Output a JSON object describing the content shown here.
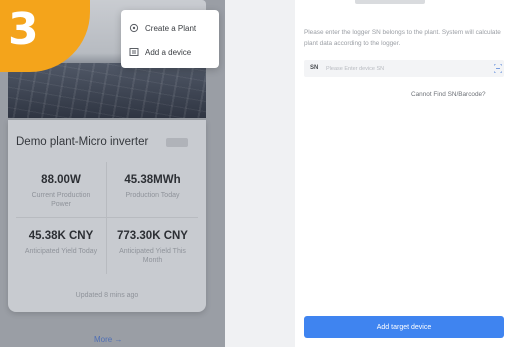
{
  "step": {
    "number": "3"
  },
  "dropdown": {
    "items": [
      {
        "label": "Create a Plant",
        "icon": "plant-icon"
      },
      {
        "label": "Add a device",
        "icon": "device-icon"
      }
    ]
  },
  "plant": {
    "title": "Demo plant-Micro inverter",
    "stats": [
      {
        "value": "88.00W",
        "label": "Current Production Power"
      },
      {
        "value": "45.38MWh",
        "label": "Production Today"
      },
      {
        "value": "45.38K CNY",
        "label": "Anticipated Yield Today"
      },
      {
        "value": "773.30K CNY",
        "label": "Anticipated Yield This Month"
      }
    ],
    "updated": "Updated 8 mins ago",
    "more": "More →"
  },
  "add_device": {
    "instructions": "Please enter the logger SN belongs to the plant. System will calculate plant data according to the logger.",
    "sn_label": "SN",
    "sn_placeholder": "Please Enter device SN",
    "cannot_find": "Cannot Find SN/Barcode?",
    "submit": "Add target device"
  },
  "colors": {
    "accent": "#3f84f0",
    "badge": "#f4a41b"
  }
}
